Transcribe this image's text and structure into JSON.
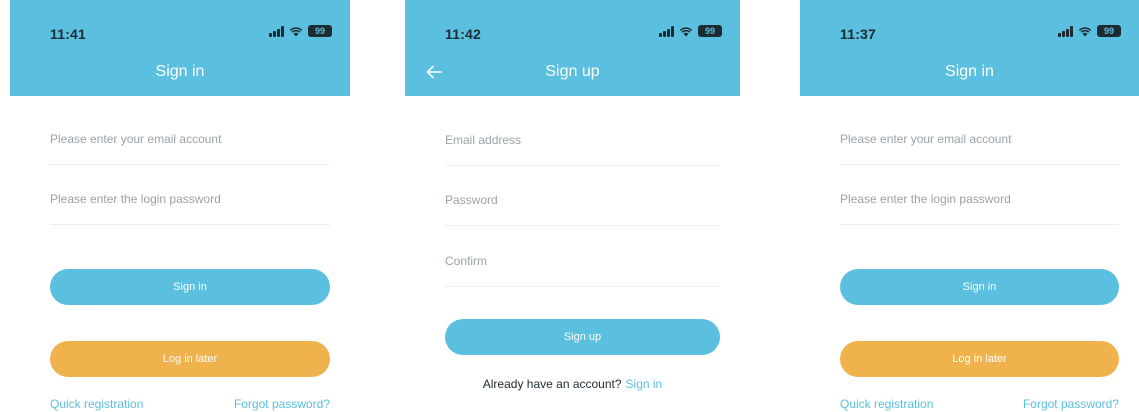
{
  "screens": [
    {
      "time": "11:41",
      "battery": "99",
      "title": "Sign in",
      "email_placeholder": "Please enter your email account",
      "password_placeholder": "Please enter the login password",
      "signin_label": "Sign in",
      "later_label": "Log in later",
      "quick_registration": "Quick registration",
      "forgot_password": "Forgot password?"
    },
    {
      "time": "11:42",
      "battery": "99",
      "back_icon": "arrow-left-icon",
      "title": "Sign up",
      "email_placeholder": "Email address",
      "password_placeholder": "Password",
      "confirm_placeholder": "Confirm",
      "signup_label": "Sign up",
      "already_text": "Already have an account?",
      "signin_link": "Sign in"
    },
    {
      "time": "11:37",
      "battery": "99",
      "title": "Sign in",
      "email_placeholder": "Please enter your email account",
      "password_placeholder": "Please enter the login password",
      "signin_label": "Sign in",
      "later_label": "Log in later",
      "quick_registration": "Quick registration",
      "forgot_password": "Forgot password?"
    }
  ],
  "colors": {
    "header": "#5bbfdf",
    "primary_button": "#5bbfdf",
    "secondary_button": "#efb24d",
    "link": "#5bbfdf"
  }
}
